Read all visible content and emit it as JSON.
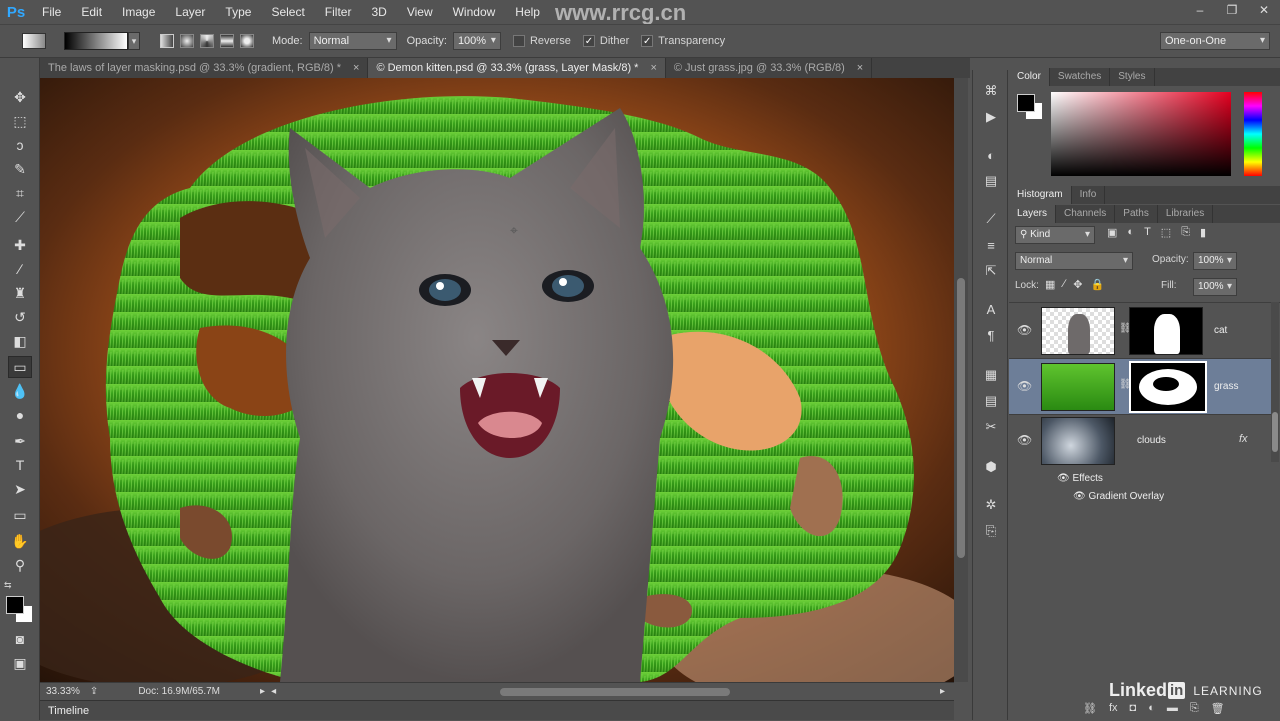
{
  "app": {
    "logo": "Ps"
  },
  "menu": [
    "File",
    "Edit",
    "Image",
    "Layer",
    "Type",
    "Select",
    "Filter",
    "3D",
    "View",
    "Window",
    "Help"
  ],
  "window_controls": {
    "min": "–",
    "max": "❐",
    "close": "✕"
  },
  "options_bar": {
    "mode_label": "Mode:",
    "mode_value": "Normal",
    "opacity_label": "Opacity:",
    "opacity_value": "100%",
    "reverse_label": "Reverse",
    "reverse_checked": false,
    "dither_label": "Dither",
    "dither_checked": true,
    "transparency_label": "Transparency",
    "transparency_checked": true,
    "workspace_value": "One-on-One"
  },
  "doc_tabs": [
    {
      "label": "The laws of layer masking.psd @ 33.3% (gradient, RGB/8) *",
      "close": "×"
    },
    {
      "label": "© Demon kitten.psd @ 33.3% (grass, Layer Mask/8) *",
      "close": "×",
      "active": true
    },
    {
      "label": "© Just grass.jpg @ 33.3% (RGB/8)",
      "close": "×"
    }
  ],
  "status": {
    "zoom": "33.33%",
    "doc": "Doc: 16.9M/65.7M"
  },
  "timeline_label": "Timeline",
  "panels": {
    "color_tabs": [
      "Color",
      "Swatches",
      "Styles"
    ],
    "hist_tabs": [
      "Histogram",
      "Info"
    ],
    "layer_tabs": [
      "Layers",
      "Channels",
      "Paths",
      "Libraries"
    ],
    "kind_label": "Kind",
    "blend_mode": "Normal",
    "opacity_label": "Opacity:",
    "opacity_value": "100%",
    "lock_label": "Lock:",
    "fill_label": "Fill:",
    "fill_value": "100%"
  },
  "layers": [
    {
      "name": "cat"
    },
    {
      "name": "grass",
      "selected": true
    },
    {
      "name": "clouds",
      "fx": "fx"
    }
  ],
  "effects": {
    "label": "Effects",
    "items": [
      "Gradient Overlay"
    ]
  },
  "watermark": {
    "site": "www.rrcg.cn",
    "brand": "Linked",
    "brand_in": "in",
    "learning": "LEARNING"
  },
  "colors": {
    "accent": "#31a8ff",
    "selected_layer": "#6d7e98"
  }
}
